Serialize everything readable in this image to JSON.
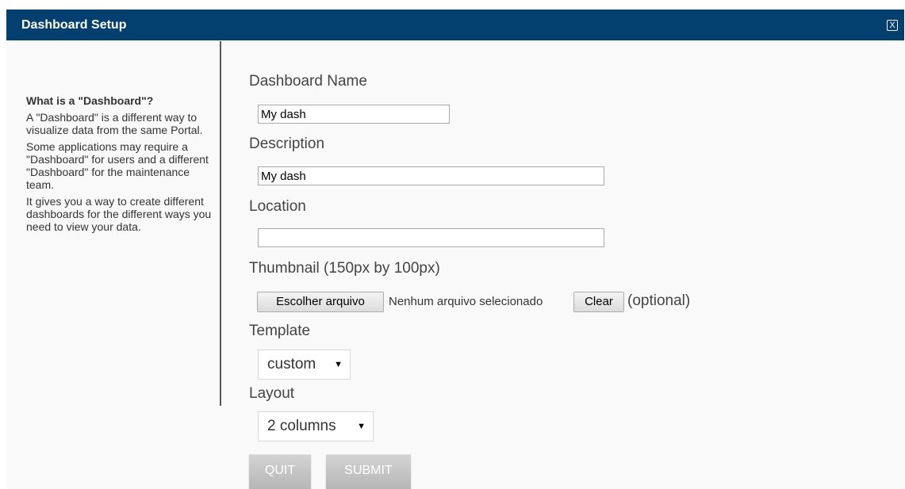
{
  "dialog": {
    "title": "Dashboard Setup",
    "close_label": "X"
  },
  "sidebar": {
    "heading": "What is a \"Dashboard\"?",
    "paragraphs": [
      "A \"Dashboard\" is a different way to visualize data from the same Portal.",
      "Some applications may require a \"Dashboard\" for users and a different \"Dashboard\" for the maintenance team.",
      "It gives you a way to create different dashboards for the different ways you need to view your data."
    ]
  },
  "form": {
    "name_label": "Dashboard Name",
    "name_value": "My dash",
    "description_label": "Description",
    "description_value": "My dash",
    "location_label": "Location",
    "location_value": "",
    "thumbnail_label": "Thumbnail (150px by 100px)",
    "choose_file_label": "Escolher arquivo",
    "file_status": "Nenhum arquivo selecionado",
    "clear_label": "Clear",
    "optional_label": "(optional)",
    "template_label": "Template",
    "template_value": "custom",
    "layout_label": "Layout",
    "layout_value": "2 columns",
    "caret": "▼"
  },
  "actions": {
    "quit_label": "QUIT",
    "submit_label": "SUBMIT"
  },
  "colors": {
    "titlebar": "#033f6f",
    "button_gray": "#c4c4c4"
  }
}
